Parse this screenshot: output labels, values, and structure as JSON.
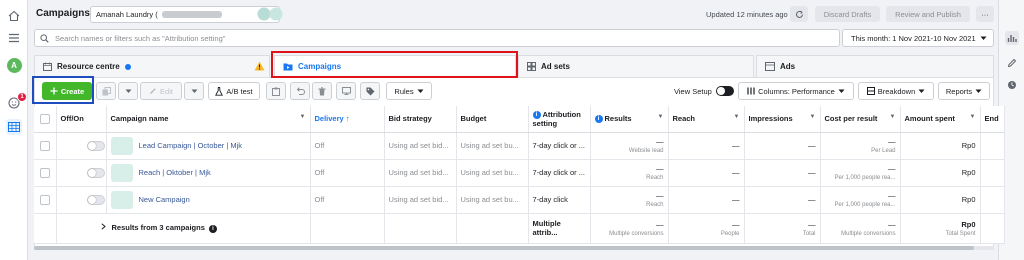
{
  "header": {
    "title": "Campaigns",
    "account_name": "Amanah Laundry (",
    "updated": "Updated 12 minutes ago",
    "discard": "Discard Drafts",
    "review": "Review and Publish",
    "more": "···"
  },
  "search": {
    "placeholder": "Search names or filters such as \"Attribution setting\"",
    "date_range": "This month: 1 Nov 2021-10 Nov 2021"
  },
  "rail": {
    "avatar": "A",
    "notification_count": "1"
  },
  "tabs": [
    {
      "label": "Resource centre"
    },
    {
      "label": "Campaigns"
    },
    {
      "label": "Ad sets"
    },
    {
      "label": "Ads"
    }
  ],
  "toolbar": {
    "create": "Create",
    "edit": "Edit",
    "ab_test": "A/B test",
    "rules": "Rules",
    "view_setup": "View Setup",
    "columns": "Columns: Performance",
    "breakdown": "Breakdown",
    "reports": "Reports"
  },
  "table": {
    "headers": {
      "off_on": "Off/On",
      "campaign_name": "Campaign name",
      "delivery": "Delivery ↑",
      "bid_strategy": "Bid strategy",
      "budget": "Budget",
      "attribution": "Attribution setting",
      "results": "Results",
      "reach": "Reach",
      "impressions": "Impressions",
      "cost_per_result": "Cost per result",
      "amount_spent": "Amount spent",
      "ends": "End"
    },
    "rows": [
      {
        "name": "Lead Campaign | October | Mjk",
        "delivery": "Off",
        "bid": "Using ad set bid...",
        "budget": "Using ad set bu...",
        "attribution": "7-day click or ...",
        "results": "—",
        "results_sub": "Website lead",
        "reach": "—",
        "impressions": "—",
        "cost": "—",
        "cost_sub": "Per Lead",
        "spent": "Rp0"
      },
      {
        "name": "Reach | Oktober | Mjk",
        "delivery": "Off",
        "bid": "Using ad set bid...",
        "budget": "Using ad set bu...",
        "attribution": "7-day click or ...",
        "results": "—",
        "results_sub": "Reach",
        "reach": "—",
        "impressions": "—",
        "cost": "—",
        "cost_sub": "Per 1,000 people rea...",
        "spent": "Rp0"
      },
      {
        "name": "New Campaign",
        "delivery": "Off",
        "bid": "Using ad set bid...",
        "budget": "Using ad set bu...",
        "attribution": "7-day click",
        "results": "—",
        "results_sub": "Reach",
        "reach": "—",
        "impressions": "—",
        "cost": "—",
        "cost_sub": "Per 1,000 people rea...",
        "spent": "Rp0"
      }
    ],
    "summary": {
      "label": "Results from 3 campaigns",
      "attribution": "Multiple attrib...",
      "results": "—",
      "results_sub": "Multiple conversions",
      "reach": "—",
      "reach_sub": "People",
      "impressions": "—",
      "impressions_sub": "Total",
      "cost": "—",
      "cost_sub": "Multiple conversions",
      "spent": "Rp0",
      "spent_sub": "Total Spent"
    }
  }
}
